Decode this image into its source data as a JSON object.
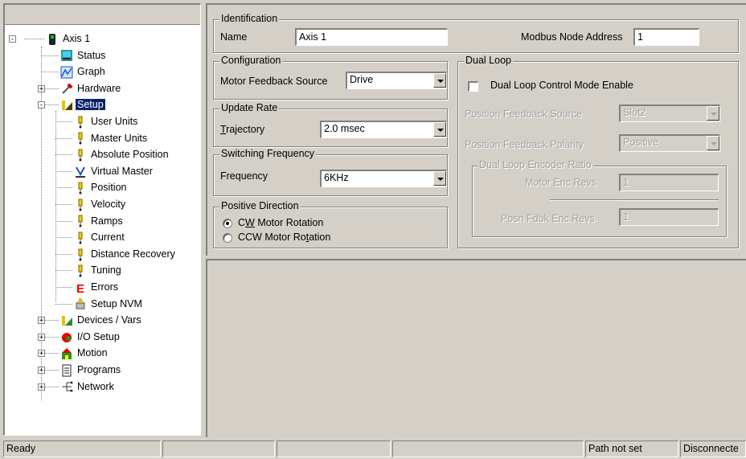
{
  "tree": {
    "items": [
      {
        "label": "Axis 1",
        "icon": "axis-icon",
        "expander": "-"
      },
      {
        "label": "Status",
        "icon": "status-icon"
      },
      {
        "label": "Graph",
        "icon": "graph-icon"
      },
      {
        "label": "Hardware",
        "icon": "hardware-icon",
        "expander": "+"
      },
      {
        "label": "Setup",
        "icon": "setup-icon",
        "expander": "-",
        "selected": true
      },
      {
        "label": "User Units",
        "icon": "param-icon"
      },
      {
        "label": "Master Units",
        "icon": "param-icon"
      },
      {
        "label": "Absolute Position",
        "icon": "param-icon"
      },
      {
        "label": "Virtual Master",
        "icon": "virtual-master-icon"
      },
      {
        "label": "Position",
        "icon": "param-icon"
      },
      {
        "label": "Velocity",
        "icon": "param-icon"
      },
      {
        "label": "Ramps",
        "icon": "param-icon"
      },
      {
        "label": "Current",
        "icon": "param-icon"
      },
      {
        "label": "Distance Recovery",
        "icon": "param-icon"
      },
      {
        "label": "Tuning",
        "icon": "param-icon"
      },
      {
        "label": "Errors",
        "icon": "errors-icon"
      },
      {
        "label": "Setup NVM",
        "icon": "nvm-icon"
      },
      {
        "label": "Devices / Vars",
        "icon": "devices-icon",
        "expander": "+"
      },
      {
        "label": "I/O Setup",
        "icon": "io-icon",
        "expander": "+"
      },
      {
        "label": "Motion",
        "icon": "motion-icon",
        "expander": "+"
      },
      {
        "label": "Programs",
        "icon": "programs-icon",
        "expander": "+"
      },
      {
        "label": "Network",
        "icon": "network-icon",
        "expander": "+"
      }
    ]
  },
  "identification": {
    "legend": "Identification",
    "name_label": "Name",
    "name_value": "Axis 1",
    "modbus_label": "Modbus Node Address",
    "modbus_value": "1"
  },
  "configuration": {
    "legend": "Configuration",
    "motor_feedback_label": "Motor Feedback Source",
    "motor_feedback_value": "Drive"
  },
  "update_rate": {
    "legend": "Update Rate",
    "trajectory_label_u": "T",
    "trajectory_label_rest": "rajectory",
    "trajectory_value": "2.0 msec"
  },
  "switching": {
    "legend": "Switching Frequency",
    "frequency_label": "Frequency",
    "frequency_value": "6KHz"
  },
  "positive_direction": {
    "legend": "Positive Direction",
    "cw_pre": "C",
    "cw_u": "W",
    "cw_post": " Motor Rotation",
    "ccw_pre": "CCW Motor Ro",
    "ccw_u": "t",
    "ccw_post": "ation",
    "selected": "cw"
  },
  "dual_loop": {
    "legend": "Dual Loop",
    "enable_label": "Dual Loop Control Mode Enable",
    "enabled": false,
    "pos_fb_source_label": "Position Feedback Source",
    "pos_fb_source_value": "Slot2",
    "pos_fb_polarity_label": "Position Feedback Polarity",
    "pos_fb_polarity_value": "Positive",
    "encoder_ratio_legend": "Dual Loop Encoder Ratio",
    "motor_enc_label": "Motor Enc Revs",
    "motor_enc_value": "1",
    "posn_fdbk_label": "Posn Fdbk Enc Revs",
    "posn_fdbk_value": "1"
  },
  "status_bar": {
    "ready": "Ready",
    "path": "Path not set",
    "connection": "Disconnecte"
  }
}
